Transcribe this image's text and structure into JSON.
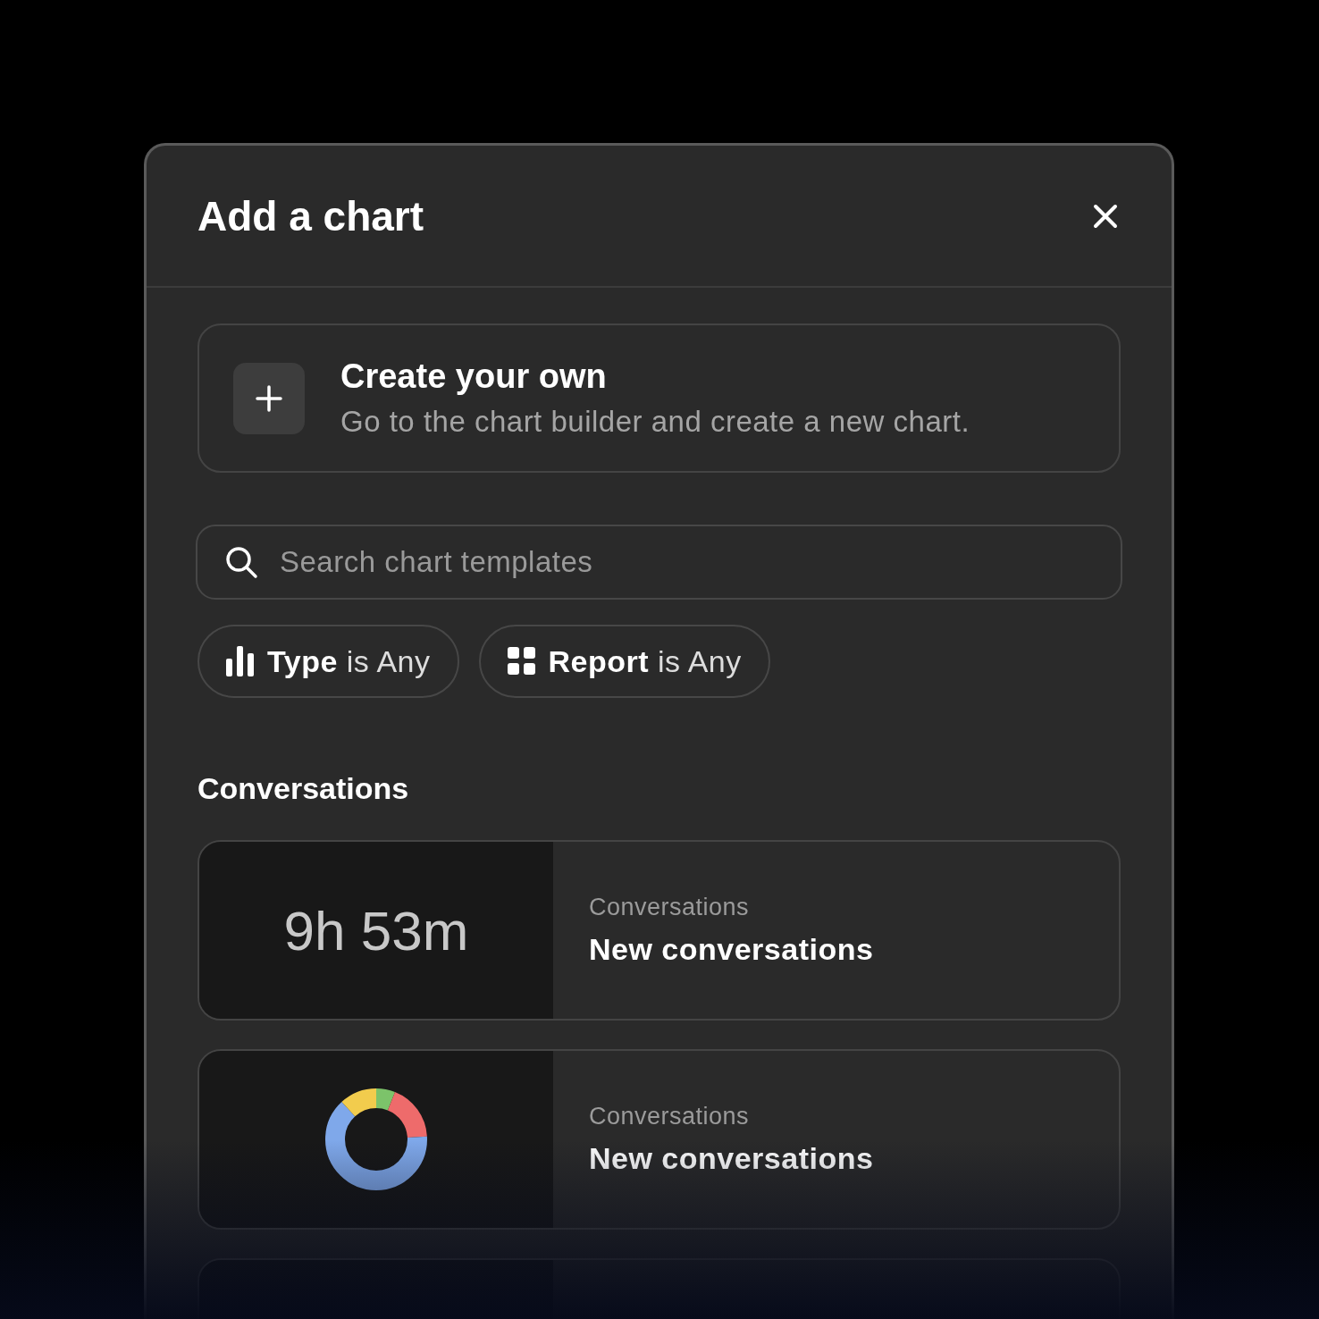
{
  "dialog": {
    "title": "Add a chart"
  },
  "create_card": {
    "title": "Create your own",
    "description": "Go to the chart builder and create a new chart."
  },
  "search": {
    "placeholder": "Search chart templates"
  },
  "filters": [
    {
      "kind": "bar",
      "label": "**Type** is Any"
    },
    {
      "kind": "grid",
      "label": "**Report** is Any"
    }
  ],
  "section": {
    "title": "Conversations"
  },
  "templates": [
    {
      "kind": "metric",
      "value": "9h 53m",
      "category": "Conversations",
      "title": "New conversations"
    },
    {
      "kind": "donut",
      "category": "Conversations",
      "title": "New conversations"
    },
    {
      "kind": "partial"
    }
  ]
}
